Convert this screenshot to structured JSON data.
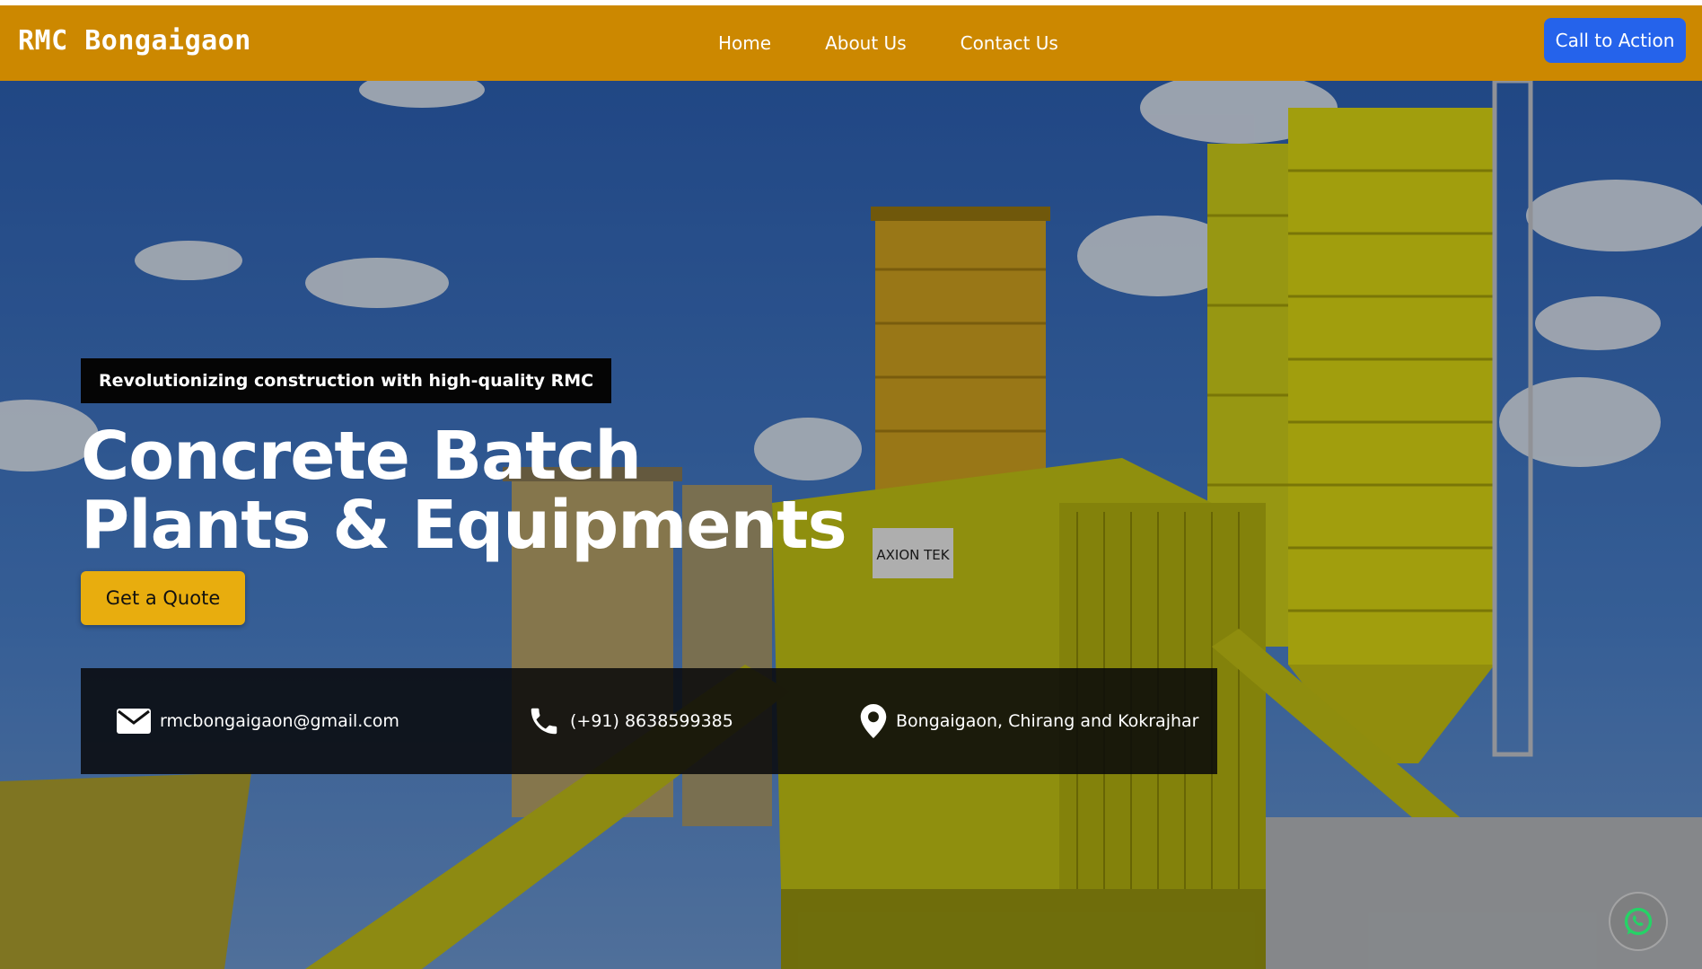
{
  "nav": {
    "brand": "RMC Bongaigaon",
    "links": [
      "Home",
      "About Us",
      "Contact Us"
    ],
    "cta_label": "Call to Action",
    "bg_color": "#cc8800",
    "cta_color": "#2563eb"
  },
  "hero": {
    "tagline": "Revolutionizing construction with high-quality RMC",
    "headline_line1": "Concrete Batch",
    "headline_line2": "Plants & Equipments",
    "quote_label": "Get a Quote",
    "quote_color": "#e8ad0e",
    "sign_text": "AXION TEK"
  },
  "contact": {
    "email": "rmcbongaigaon@gmail.com",
    "phone": "(+91) 8638599385",
    "location": "Bongaigaon, Chirang and Kokrajhar",
    "email_icon": "envelope-icon",
    "phone_icon": "phone-icon",
    "location_icon": "map-pin-icon"
  },
  "floating": {
    "whatsapp_icon": "whatsapp-icon"
  }
}
